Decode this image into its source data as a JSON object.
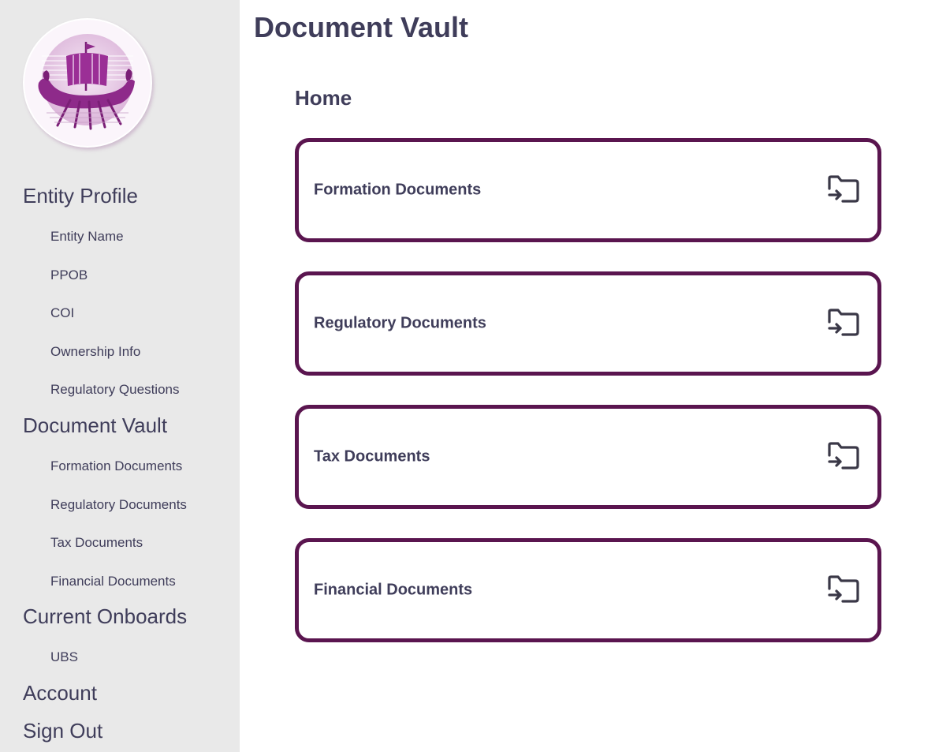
{
  "app": {
    "title": "Document Vault",
    "logo_icon": "viking-ship-logo-icon"
  },
  "sidebar": {
    "sections": [
      {
        "label": "Entity Profile",
        "items": [
          "Entity Name",
          "PPOB",
          "COI",
          "Ownership Info",
          "Regulatory Questions"
        ]
      },
      {
        "label": "Document Vault",
        "items": [
          "Formation Documents",
          "Regulatory Documents",
          "Tax Documents",
          "Financial Documents"
        ]
      },
      {
        "label": "Current Onboards",
        "items": [
          "UBS"
        ]
      },
      {
        "label": "Account",
        "items": []
      },
      {
        "label": "Sign Out",
        "items": []
      }
    ]
  },
  "main": {
    "breadcrumb": "Home",
    "cards": [
      {
        "label": "Formation Documents",
        "icon": "folder-open-icon"
      },
      {
        "label": "Regulatory Documents",
        "icon": "folder-open-icon"
      },
      {
        "label": "Tax Documents",
        "icon": "folder-open-icon"
      },
      {
        "label": "Financial Documents",
        "icon": "folder-open-icon"
      }
    ]
  },
  "colors": {
    "sidebar_bg": "#e9e9e9",
    "text": "#3f3d5a",
    "card_border": "#5a154f",
    "logo_purple": "#8e2a8a"
  }
}
